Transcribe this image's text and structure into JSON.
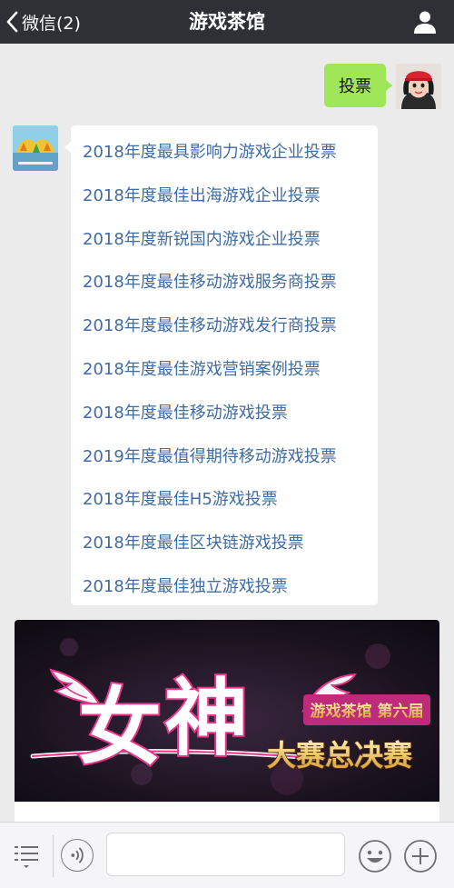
{
  "header": {
    "back_label": "微信(2)",
    "title": "游戏茶馆"
  },
  "outgoing": {
    "text": "投票"
  },
  "vote_list": [
    "2018年度最具影响力游戏企业投票",
    "2018年度最佳出海游戏企业投票",
    "2018年度新锐国内游戏企业投票",
    "2018年度最佳移动游戏服务商投票",
    "2018年度最佳移动游戏发行商投票",
    "2018年度最佳游戏营销案例投票",
    "2018年度最佳移动游戏投票",
    "2019年度最值得期待移动游戏投票",
    "2018年度最佳H5游戏投票",
    "2018年度最佳区块链游戏投票",
    "2018年度最佳独立游戏投票"
  ],
  "banner": {
    "big_text_1": "女",
    "big_text_2": "神",
    "subtitle_1": "游戏茶馆 第六届",
    "subtitle_2": "大赛总决赛"
  },
  "input": {
    "placeholder": ""
  },
  "colors": {
    "navbar_bg": "#2f3035",
    "chat_bg": "#ebebeb",
    "outgoing_bubble": "#9fe658",
    "link_text": "#3f6ca3",
    "banner_accent": "#e8358a"
  },
  "icons": {
    "back": "chevron-left-icon",
    "profile": "person-icon",
    "menu": "menu-icon",
    "voice": "voice-icon",
    "emoji": "emoji-icon",
    "plus": "plus-icon"
  }
}
